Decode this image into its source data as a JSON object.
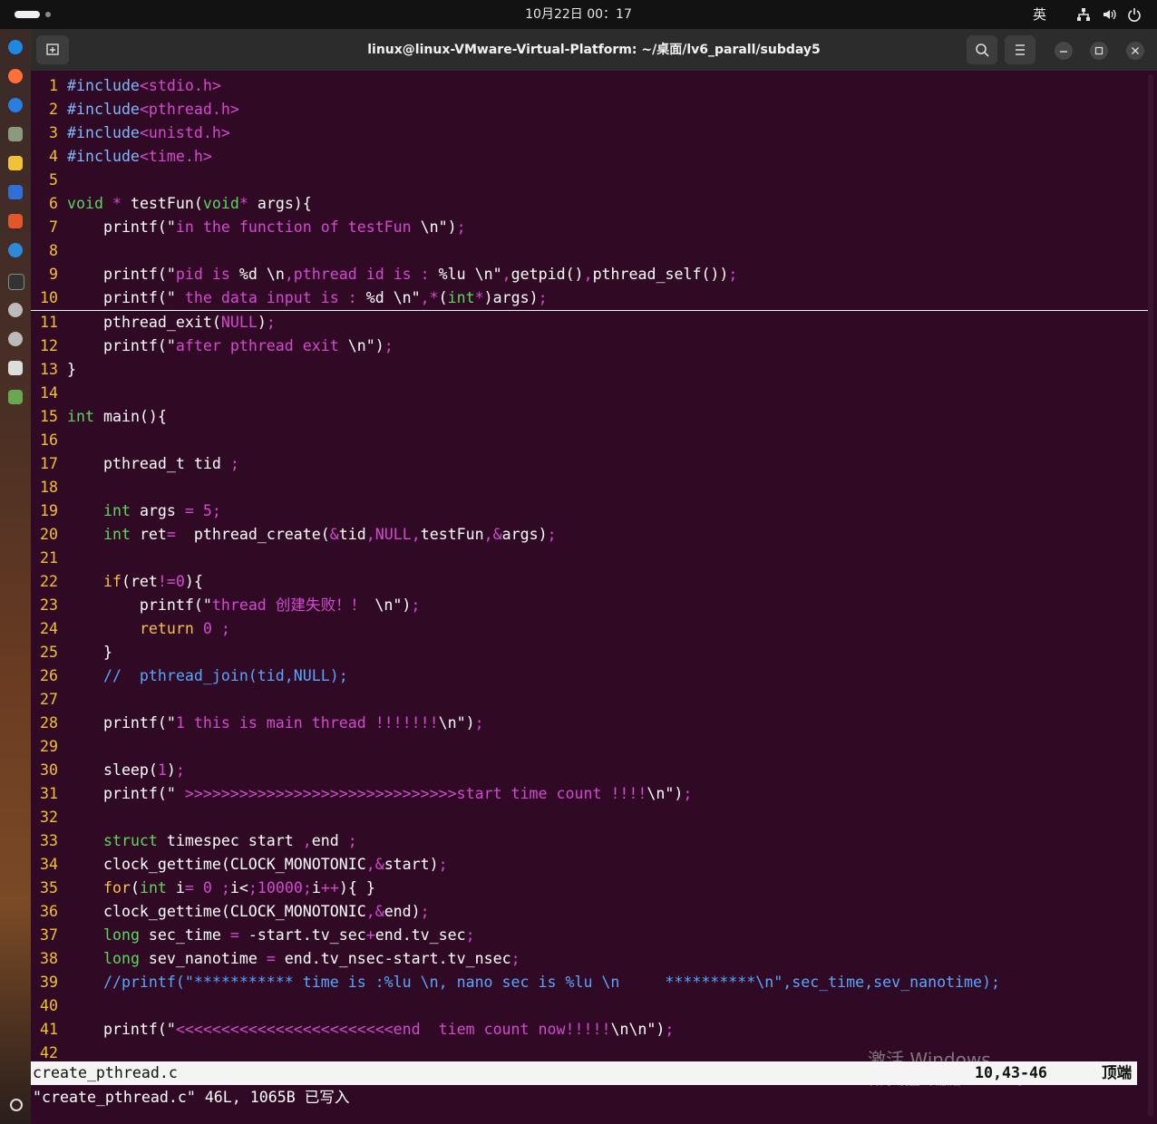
{
  "topbar": {
    "clock": "10月22日 00：17",
    "ime": "英",
    "tray_icons": [
      "network-icon",
      "volume-icon",
      "power-icon"
    ]
  },
  "window": {
    "title": "linux@linux-VMware-Virtual-Platform: ~/桌面/lv6_parall/subday5",
    "buttons": [
      "new-tab-icon",
      "search-icon",
      "menu-icon",
      "minimize-icon",
      "restore-icon",
      "close-icon"
    ]
  },
  "editor": {
    "lines": [
      {
        "n": "1",
        "t": "#include<stdio.h>"
      },
      {
        "n": "2",
        "t": "#include<pthread.h>"
      },
      {
        "n": "3",
        "t": "#include<unistd.h>"
      },
      {
        "n": "4",
        "t": "#include<time.h>"
      },
      {
        "n": "5",
        "t": ""
      },
      {
        "n": "6",
        "t": "void * testFun(void* args){"
      },
      {
        "n": "7",
        "t": "    printf(\"in the function of testFun \\n\");"
      },
      {
        "n": "8",
        "t": ""
      },
      {
        "n": "9",
        "t": "    printf(\"pid is %d \\n,pthread id is : %lu \\n\",getpid(),pthread_self());"
      },
      {
        "n": "10",
        "t": "    printf(\" the data input is : %d \\n\",*(int*)args);"
      },
      {
        "n": "11",
        "t": "    pthread_exit(NULL);"
      },
      {
        "n": "12",
        "t": "    printf(\"after pthread exit \\n\");"
      },
      {
        "n": "13",
        "t": "}"
      },
      {
        "n": "14",
        "t": ""
      },
      {
        "n": "15",
        "t": "int main(){"
      },
      {
        "n": "16",
        "t": ""
      },
      {
        "n": "17",
        "t": "    pthread_t tid ;"
      },
      {
        "n": "18",
        "t": ""
      },
      {
        "n": "19",
        "t": "    int args = 5;"
      },
      {
        "n": "20",
        "t": "    int ret=  pthread_create(&tid,NULL,testFun,&args);"
      },
      {
        "n": "21",
        "t": ""
      },
      {
        "n": "22",
        "t": "    if(ret!=0){"
      },
      {
        "n": "23",
        "t": "        printf(\"thread 创建失败！！ \\n\");"
      },
      {
        "n": "24",
        "t": "        return 0 ;"
      },
      {
        "n": "25",
        "t": "    }"
      },
      {
        "n": "26",
        "t": "    //  pthread_join(tid,NULL);"
      },
      {
        "n": "27",
        "t": ""
      },
      {
        "n": "28",
        "t": "    printf(\"1 this is main thread !!!!!!!\\n\");"
      },
      {
        "n": "29",
        "t": ""
      },
      {
        "n": "30",
        "t": "    sleep(1);"
      },
      {
        "n": "31",
        "t": "    printf(\" >>>>>>>>>>>>>>>>>>>>>>>>>>>>>>start time count !!!!\\n\");"
      },
      {
        "n": "32",
        "t": ""
      },
      {
        "n": "33",
        "t": "    struct timespec start ,end ;"
      },
      {
        "n": "34",
        "t": "    clock_gettime(CLOCK_MONOTONIC,&start);"
      },
      {
        "n": "35",
        "t": "    for(int i= 0 ;i<10000;i++){ }"
      },
      {
        "n": "36",
        "t": "    clock_gettime(CLOCK_MONOTONIC,&end);"
      },
      {
        "n": "37",
        "t": "    long sec_time = -start.tv_sec+end.tv_sec;"
      },
      {
        "n": "38",
        "t": "    long sev_nanotime = end.tv_nsec-start.tv_nsec;"
      },
      {
        "n": "39",
        "t": "    //printf(\"*********** time is :%lu \\n, nano sec is %lu \\n     **********\\n\",sec_time,sev_nanotime);"
      },
      {
        "n": "40",
        "t": ""
      },
      {
        "n": "41",
        "t": "    printf(\"<<<<<<<<<<<<<<<<<<<<<<<<end  tiem count now!!!!!\\n\\n\");"
      },
      {
        "n": "42",
        "t": ""
      }
    ]
  },
  "statusline": {
    "file": "create_pthread.c",
    "position": "10,43-46",
    "scroll": "顶端"
  },
  "cmdline": "\"create_pthread.c\" 46L, 1065B 已写入",
  "watermark": {
    "title": "激活 Windows",
    "subtitle": "转到\"设置\"以激活 Windows。"
  }
}
